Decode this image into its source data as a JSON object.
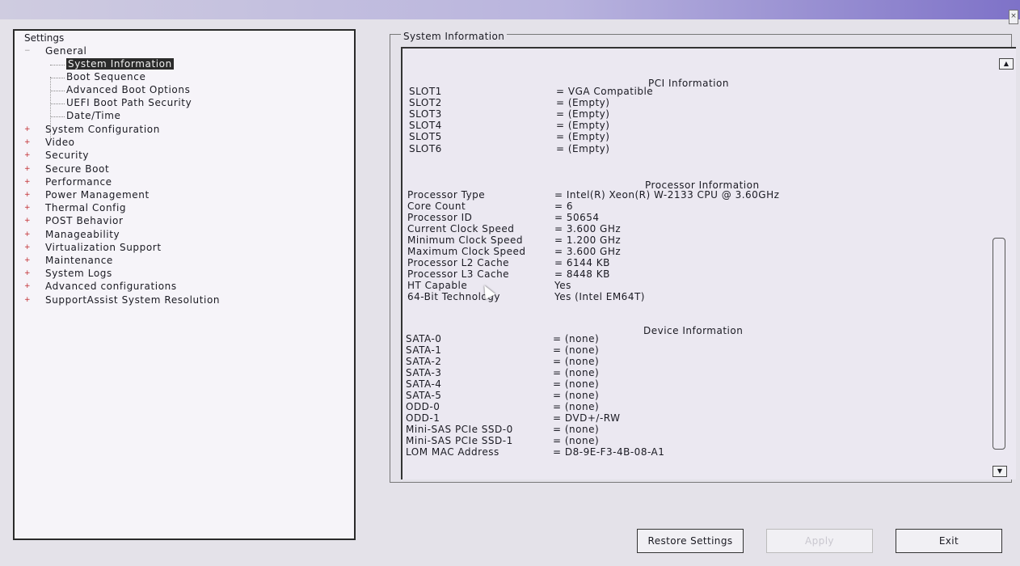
{
  "window": {
    "close_label": "×"
  },
  "tree": {
    "title": "Settings",
    "general": {
      "label": "General",
      "children": [
        "System Information",
        "Boot Sequence",
        "Advanced Boot Options",
        "UEFI Boot Path Security",
        "Date/Time"
      ],
      "selected_index": 0
    },
    "categories": [
      "System Configuration",
      "Video",
      "Security",
      "Secure Boot",
      "Performance",
      "Power Management",
      "Thermal Config",
      "POST Behavior",
      "Manageability",
      "Virtualization Support",
      "Maintenance",
      "System Logs",
      "Advanced configurations",
      "SupportAssist System Resolution"
    ]
  },
  "panel": {
    "title": "System Information",
    "pci": {
      "heading": "PCI Information",
      "rows": [
        {
          "key": "SLOT1",
          "value": "= VGA Compatible"
        },
        {
          "key": "SLOT2",
          "value": "= (Empty)"
        },
        {
          "key": "SLOT3",
          "value": "= (Empty)"
        },
        {
          "key": "SLOT4",
          "value": "= (Empty)"
        },
        {
          "key": "SLOT5",
          "value": "= (Empty)"
        },
        {
          "key": "SLOT6",
          "value": "= (Empty)"
        }
      ]
    },
    "processor": {
      "heading": "Processor Information",
      "rows": [
        {
          "key": "Processor Type",
          "value": "= Intel(R) Xeon(R) W-2133 CPU @ 3.60GHz"
        },
        {
          "key": "Core Count",
          "value": "= 6"
        },
        {
          "key": "Processor ID",
          "value": "= 50654"
        },
        {
          "key": "Current Clock Speed",
          "value": "= 3.600 GHz"
        },
        {
          "key": "Minimum Clock Speed",
          "value": "= 1.200 GHz"
        },
        {
          "key": "Maximum Clock Speed",
          "value": "= 3.600 GHz"
        },
        {
          "key": "Processor L2 Cache",
          "value": "= 6144 KB"
        },
        {
          "key": "Processor L3 Cache",
          "value": "= 8448 KB"
        },
        {
          "key": "HT Capable",
          "value": "Yes"
        },
        {
          "key": "64-Bit Technology",
          "value": "Yes (Intel EM64T)"
        }
      ]
    },
    "device": {
      "heading": "Device Information",
      "rows": [
        {
          "key": "SATA-0",
          "value": "= (none)"
        },
        {
          "key": "SATA-1",
          "value": "= (none)"
        },
        {
          "key": "SATA-2",
          "value": "= (none)"
        },
        {
          "key": "SATA-3",
          "value": "= (none)"
        },
        {
          "key": "SATA-4",
          "value": "= (none)"
        },
        {
          "key": "SATA-5",
          "value": "= (none)"
        },
        {
          "key": "ODD-0",
          "value": "= (none)"
        },
        {
          "key": "ODD-1",
          "value": "= DVD+/-RW"
        },
        {
          "key": "Mini-SAS PCIe SSD-0",
          "value": "= (none)"
        },
        {
          "key": "Mini-SAS PCIe SSD-1",
          "value": "= (none)"
        },
        {
          "key": "LOM MAC Address",
          "value": "= D8-9E-F3-4B-08-A1"
        }
      ]
    }
  },
  "buttons": {
    "restore": "Restore Settings",
    "apply": "Apply",
    "exit": "Exit"
  },
  "icons": {
    "expand": "+",
    "collapse": "−",
    "scroll_up": "▲",
    "scroll_down": "▼"
  }
}
